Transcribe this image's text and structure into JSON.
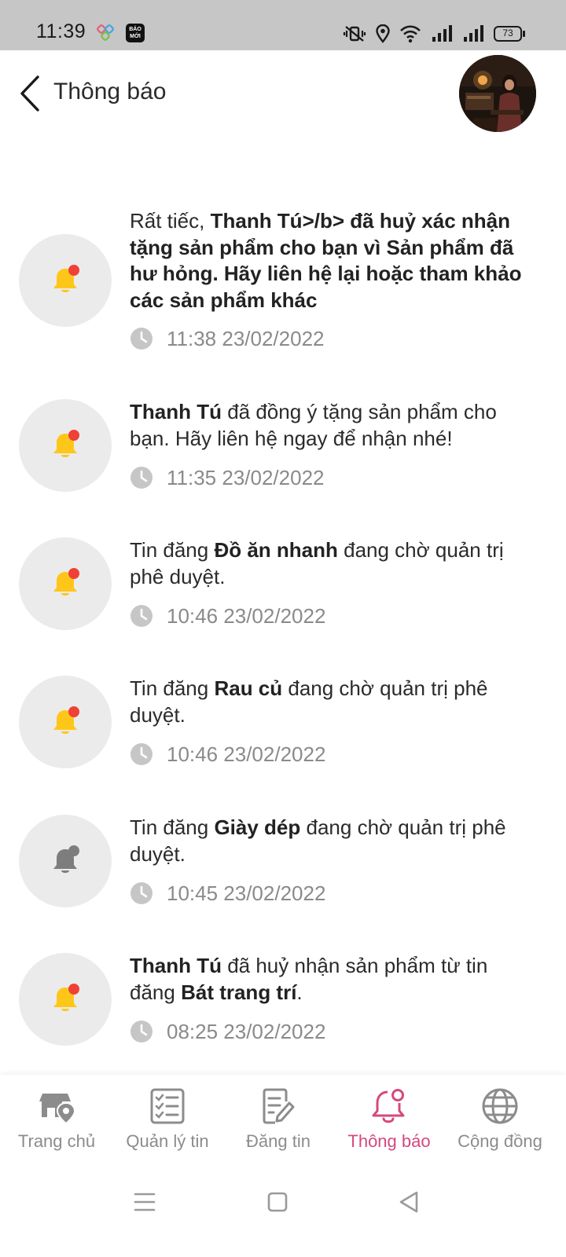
{
  "status_bar": {
    "time": "11:39",
    "app_badge": "BÁO MỚI",
    "battery": "73"
  },
  "header": {
    "title": "Thông báo",
    "back_icon": "chevron-left-icon"
  },
  "notifications": [
    {
      "parts": [
        {
          "t": "Rất tiếc, ",
          "b": false
        },
        {
          "t": "Thanh Tú>/b> đã huỷ xác nhận tặng sản phẩm cho bạn vì Sản phẩm đã hư hỏng. Hãy liên hệ lại hoặc tham khảo các sản phẩm khác",
          "b": true
        }
      ],
      "time": "11:38 23/02/2022",
      "unread": true
    },
    {
      "parts": [
        {
          "t": "Thanh Tú",
          "b": true
        },
        {
          "t": " đã đồng ý tặng sản phẩm cho bạn. Hãy liên hệ ngay để nhận nhé!",
          "b": false
        }
      ],
      "time": "11:35 23/02/2022",
      "unread": true
    },
    {
      "parts": [
        {
          "t": "Tin đăng ",
          "b": false
        },
        {
          "t": "Đồ ăn nhanh",
          "b": true
        },
        {
          "t": " đang chờ quản trị phê duyệt.",
          "b": false
        }
      ],
      "time": "10:46 23/02/2022",
      "unread": true
    },
    {
      "parts": [
        {
          "t": "Tin đăng ",
          "b": false
        },
        {
          "t": "Rau củ",
          "b": true
        },
        {
          "t": " đang chờ quản trị phê duyệt.",
          "b": false
        }
      ],
      "time": "10:46 23/02/2022",
      "unread": true
    },
    {
      "parts": [
        {
          "t": "Tin đăng ",
          "b": false
        },
        {
          "t": "Giày dép",
          "b": true
        },
        {
          "t": " đang chờ quản trị phê duyệt.",
          "b": false
        }
      ],
      "time": "10:45 23/02/2022",
      "unread": false
    },
    {
      "parts": [
        {
          "t": "Thanh Tú",
          "b": true
        },
        {
          "t": " đã huỷ nhận sản phẩm từ tin đăng ",
          "b": false
        },
        {
          "t": "Bát trang trí",
          "b": true
        },
        {
          "t": ".",
          "b": false
        }
      ],
      "time": "08:25 23/02/2022",
      "unread": true
    }
  ],
  "bottom_nav": {
    "items": [
      {
        "label": "Trang chủ",
        "icon": "store-location-icon",
        "active": false
      },
      {
        "label": "Quản lý tin",
        "icon": "checklist-icon",
        "active": false
      },
      {
        "label": "Đăng tin",
        "icon": "edit-document-icon",
        "active": false
      },
      {
        "label": "Thông báo",
        "icon": "bell-icon",
        "active": true
      },
      {
        "label": "Cộng đồng",
        "icon": "globe-icon",
        "active": false
      }
    ]
  },
  "colors": {
    "accent": "#d6487d",
    "bell_unread": "#ffc61a",
    "bell_read": "#7d7d7d",
    "dot_unread": "#ef4136",
    "icon_bg": "#ebebeb",
    "muted": "#8c8c8c"
  }
}
